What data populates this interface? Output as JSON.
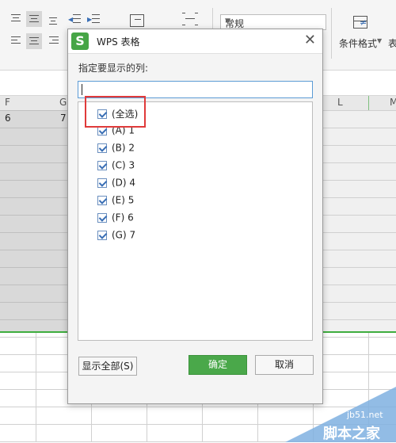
{
  "toolbar": {
    "number_format": "常规",
    "conditional_format_label": "条件格式",
    "truncated_label": "表"
  },
  "columns": {
    "f": "F",
    "g": "G",
    "l": "L",
    "m": "M"
  },
  "cells": {
    "f1": "6",
    "g1": "7"
  },
  "dialog": {
    "logo": "S",
    "title": "WPS 表格",
    "close": "✕",
    "instruction": "指定要显示的列:",
    "input_value": "",
    "items": [
      {
        "label": "(全选)",
        "checked": true
      },
      {
        "label": "(A) 1",
        "checked": true
      },
      {
        "label": "(B) 2",
        "checked": true
      },
      {
        "label": "(C) 3",
        "checked": true
      },
      {
        "label": "(D) 4",
        "checked": true
      },
      {
        "label": "(E) 5",
        "checked": true
      },
      {
        "label": "(F) 6",
        "checked": true
      },
      {
        "label": "(G) 7",
        "checked": true
      }
    ],
    "show_all_button": "显示全部(S)",
    "ok_button": "确定",
    "cancel_button": "取消"
  },
  "watermark": {
    "url": "jb51.net",
    "name": "脚本之家"
  },
  "colors": {
    "accent_green": "#46a546",
    "highlight_red": "#e03a3a"
  }
}
